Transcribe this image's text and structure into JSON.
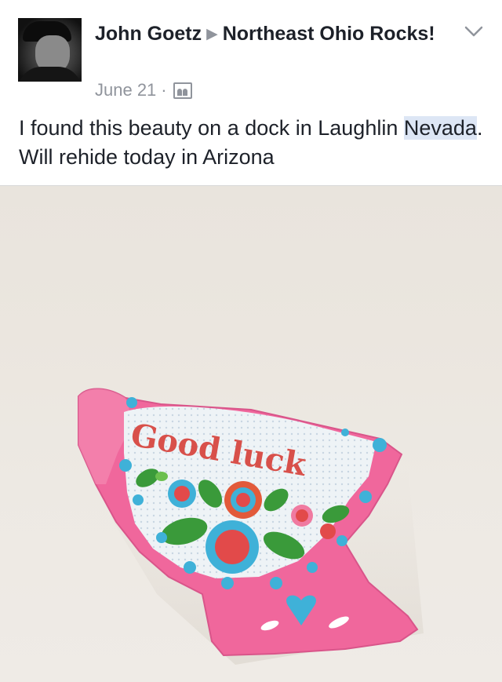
{
  "post": {
    "author": "John Goetz",
    "group": "Northeast Ohio Rocks!",
    "date": "June 21",
    "separator": "·",
    "arrow": "▶",
    "text_before": "I found this beauty on a dock in Laughlin ",
    "text_highlight": "Nevada",
    "text_after": ". Will rehide today in Arizona"
  },
  "photo": {
    "rock_text": "Good luck"
  },
  "icons": {
    "avatar": "avatar",
    "audience": "group-audience-icon",
    "menu": "chevron-down-icon"
  },
  "colors": {
    "meta_gray": "#90949c",
    "highlight": "#dde6f5",
    "rock_pink": "#f0679c",
    "text_red": "#d8504a"
  }
}
